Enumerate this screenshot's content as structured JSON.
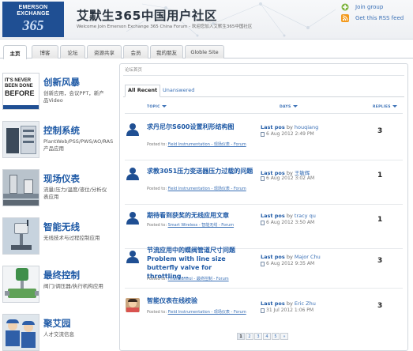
{
  "header": {
    "logo_line1": "EMERSON",
    "logo_line2": "EXCHANGE",
    "logo_line3": "365",
    "title": "艾默生365中国用户社区",
    "subtitle": "Welcome Join Emerson Exchange 365 China Forum - 欢迎您加入艾默生365中国社区",
    "join_group": "Join group",
    "rss": "Get this RSS feed",
    "brand_color": "#1f4f93"
  },
  "tabs": [
    "主页",
    "博客",
    "论坛",
    "资源共享",
    "会员",
    "我的朋友",
    "Globle Site"
  ],
  "sidebar": [
    {
      "title": "创新风暴",
      "desc": "创新应用，会议PPT，新产品Video",
      "thumb_text": [
        "IT'S NEVER",
        "BEEN DONE",
        "BEFORE"
      ]
    },
    {
      "title": "控制系统",
      "desc": "PlantWeb/PSS/PWS/AO/RAS 产品应用"
    },
    {
      "title": "现场仪表",
      "desc": "流量/压力/温度/液位/分析仪表应用"
    },
    {
      "title": "智能无线",
      "desc": "无线技术与过程控制应用"
    },
    {
      "title": "最终控制",
      "desc": "阀门/调压器/执行机构应用"
    },
    {
      "title": "聚艾园",
      "desc": "人才交流信息"
    }
  ],
  "main": {
    "breadcrumb": "论坛首页",
    "subtabs": [
      "All Recent",
      "Unanswered"
    ],
    "columns": [
      "TOPIC",
      "DAYS",
      "REPLIES"
    ],
    "posted_in_label": "Posted to:",
    "last_post_label": "Last pos",
    "by_label": "by",
    "rows": [
      {
        "topic": "求丹尼尔S600设置利形结构图",
        "forum": "Field Instrumentation - 现场仪表 - Forum",
        "user": "houqiang",
        "date": "6 Aug 2012 2:49 PM",
        "replies": "3"
      },
      {
        "topic": "求教3051压力变送器压力过载的问题",
        "forum": "Field Instrumentation - 现场仪表 - Forum",
        "user": "王敏辉",
        "date": "6 Aug 2012 3:02 AM",
        "replies": "1"
      },
      {
        "topic": "期待看到获奖的无线应用文章",
        "forum": "Smart Wireless - 智能无线 - Forum",
        "user": "tracy qu",
        "date": "6 Aug 2012 3:50 AM",
        "replies": "1"
      },
      {
        "topic": "节流应用中的蝶阀管道尺寸问题 Problem with line size butterfly valve for throttling...",
        "forum": "Final Control - 最终控制 - Forum",
        "user": "Major Chu",
        "date": "6 Aug 2012 9:35 AM",
        "replies": "3"
      },
      {
        "topic": "智能仪表在线校验",
        "forum": "Field Instrumentation - 现场仪表 - Forum",
        "user": "Eric Zhu",
        "date": "31 Jul 2012 1:06 PM",
        "replies": "3"
      }
    ],
    "pager": [
      "1",
      "2",
      "3",
      "4",
      "5",
      "»"
    ]
  }
}
